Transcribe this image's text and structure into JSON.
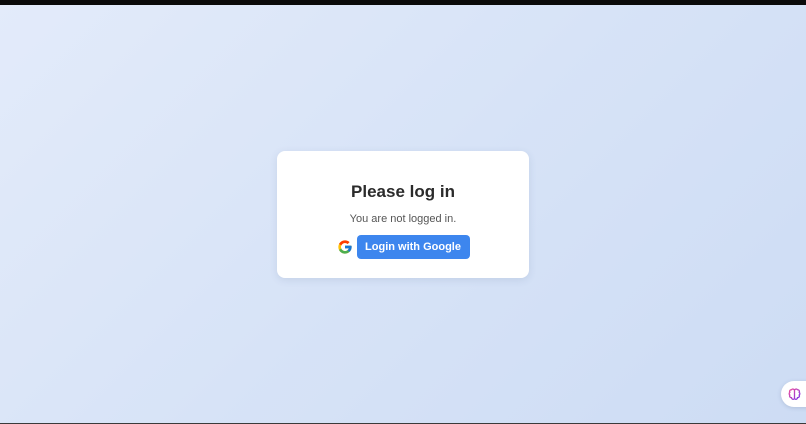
{
  "login_card": {
    "title": "Please log in",
    "status_text": "You are not logged in.",
    "login_button_label": "Login with Google"
  },
  "icons": {
    "google": "google-g-icon",
    "assistant": "brain-icon"
  },
  "colors": {
    "background_start": "#e3ebfa",
    "background_end": "#cddcf4",
    "card": "#ffffff",
    "button": "#3d86ee",
    "button_text": "#ffffff",
    "title_text": "#2b2b2b",
    "status_text": "#555555"
  }
}
